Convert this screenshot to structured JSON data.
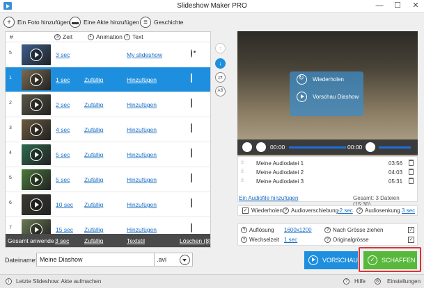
{
  "window": {
    "title": "Slideshow Maker PRO",
    "minimize": "—",
    "maximize": "☐",
    "close": "✕"
  },
  "toolbar": {
    "add_photo": "Ein Foto hinzufügen",
    "add_file": "Eine Akte hinzufügen",
    "history": "Geschichte"
  },
  "table": {
    "headers": {
      "num": "#",
      "time": "Zeit",
      "animation": "Animation",
      "text": "Text"
    },
    "rows": [
      {
        "num": "5",
        "time": "3 sec",
        "animation": "",
        "text": "My slideshow",
        "action": "eye-icon",
        "selected": false
      },
      {
        "num": "1",
        "time": "1 sec",
        "animation": "Zufällig",
        "text": "Hinzufügen",
        "action": "trash-icon",
        "selected": true
      },
      {
        "num": "2",
        "time": "2 sec",
        "animation": "Zufällig",
        "text": "Hinzufügen",
        "action": "trash-icon",
        "selected": false
      },
      {
        "num": "3",
        "time": "4 sec",
        "animation": "Zufällig",
        "text": "Hinzufügen",
        "action": "trash-icon",
        "selected": false
      },
      {
        "num": "4",
        "time": "5 sec",
        "animation": "Zufällig",
        "text": "Hinzufügen",
        "action": "trash-icon",
        "selected": false
      },
      {
        "num": "5",
        "time": "5 sec",
        "animation": "Zufällig",
        "text": "Hinzufügen",
        "action": "trash-icon",
        "selected": false
      },
      {
        "num": "6",
        "time": "10 sec",
        "animation": "Zufällig",
        "text": "Hinzufügen",
        "action": "trash-icon",
        "selected": false
      },
      {
        "num": "7",
        "time": "15 sec",
        "animation": "Zufällig",
        "text": "Hinzufügen",
        "action": "trash-icon",
        "selected": false
      }
    ],
    "footer": {
      "label": "Gesamt anwende",
      "time": "3 sec",
      "animation": "Zufällig",
      "text": "Textstil",
      "delete": "Löschen (8)"
    }
  },
  "side_buttons": {
    "up": "↑",
    "down": "↓",
    "shuffle": "⇄",
    "ab": "AB"
  },
  "preview": {
    "repeat": "Wiederholen",
    "preview_slideshow": "Vorschau Diashow",
    "time_current": "00:00",
    "time_total": "00:00"
  },
  "audio": {
    "files": [
      {
        "name": "Meine Audiodatei 1",
        "duration": "03:56"
      },
      {
        "name": "Meine Audiodatei 2",
        "duration": "04:03"
      },
      {
        "name": "Meine Audiodatei 3",
        "duration": "05:31"
      }
    ],
    "add_link": "Ein Audiofile hinzufügen",
    "total": "Gesamt: 3 Dateien (15:30)",
    "repeat_label": "Wiederholen",
    "shift_label": "Audioverschiebung",
    "shift_value": "-2 sec",
    "fade_label": "Audiosenkung",
    "fade_value": "3 sec"
  },
  "settings": {
    "resolution_label": "Auflösung",
    "resolution_value": "1600x1200",
    "fit_label": "Nach Grösse ziehen",
    "interval_label": "Wechselzeit",
    "interval_value": "1 sec",
    "original_label": "Originalgrösse"
  },
  "output": {
    "filename_label": "Dateiname:",
    "filename_value": "Meine Diashow",
    "extension": ".avi",
    "preview_button": "VORSCHAU",
    "create_button": "SCHAFFEN"
  },
  "statusbar": {
    "last": "Letzte Slideshow: Akte aufmachen",
    "help": "Hilfe",
    "settings": "Einstellungen"
  },
  "colors": {
    "accent": "#1e8fde",
    "create": "#57b83b",
    "highlight_border": "#d6343a"
  }
}
